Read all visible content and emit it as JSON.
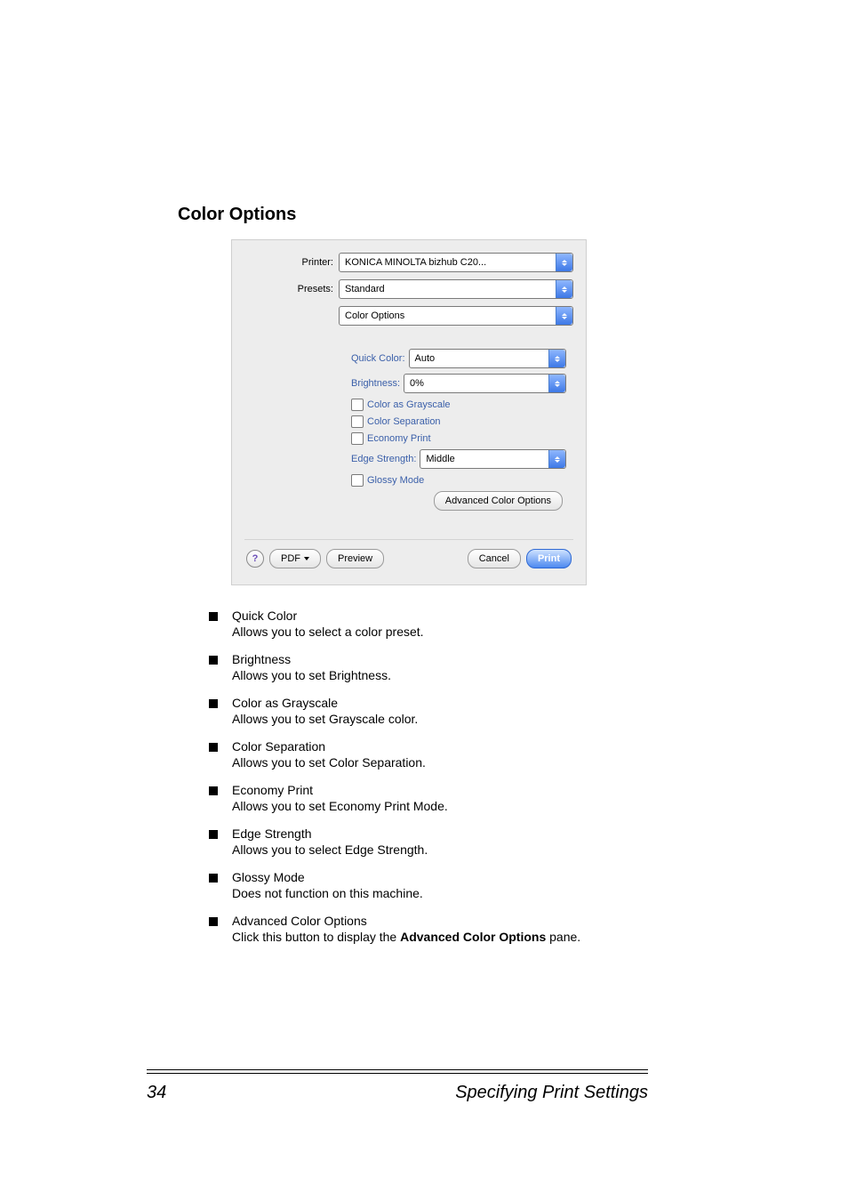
{
  "heading": "Color Options",
  "dialog": {
    "fields": {
      "printerLabel": "Printer:",
      "printerValue": "KONICA MINOLTA bizhub C20...",
      "presetsLabel": "Presets:",
      "presetsValue": "Standard",
      "panelValue": "Color Options"
    },
    "options": {
      "quickColorLabel": "Quick Color:",
      "quickColorValue": "Auto",
      "brightnessLabel": "Brightness:",
      "brightnessValue": "0%",
      "cbGrayscale": "Color as Grayscale",
      "cbSeparation": "Color Separation",
      "cbEconomy": "Economy Print",
      "edgeStrengthLabel": "Edge Strength:",
      "edgeStrengthValue": "Middle",
      "cbGlossy": "Glossy Mode",
      "advancedBtn": "Advanced Color Options"
    },
    "footer": {
      "help": "?",
      "pdf": "PDF",
      "preview": "Preview",
      "cancel": "Cancel",
      "print": "Print"
    }
  },
  "bullets": [
    {
      "title": "Quick Color",
      "desc": "Allows you to select a color preset."
    },
    {
      "title": "Brightness",
      "desc": "Allows you to set Brightness."
    },
    {
      "title": "Color as Grayscale",
      "desc": "Allows you to set Grayscale color."
    },
    {
      "title": "Color Separation",
      "desc": "Allows you to set Color Separation."
    },
    {
      "title": "Economy Print",
      "desc": "Allows you to set Economy Print Mode."
    },
    {
      "title": "Edge Strength",
      "desc": "Allows you to select Edge Strength."
    },
    {
      "title": "Glossy Mode",
      "desc": "Does not function on this machine."
    },
    {
      "title": "Advanced Color Options",
      "descPre": "Click this button to display the ",
      "descStrong": "Advanced Color Options",
      "descPost": " pane."
    }
  ],
  "pageFooter": {
    "pageNumber": "34",
    "chapterTitle": "Specifying Print Settings"
  }
}
